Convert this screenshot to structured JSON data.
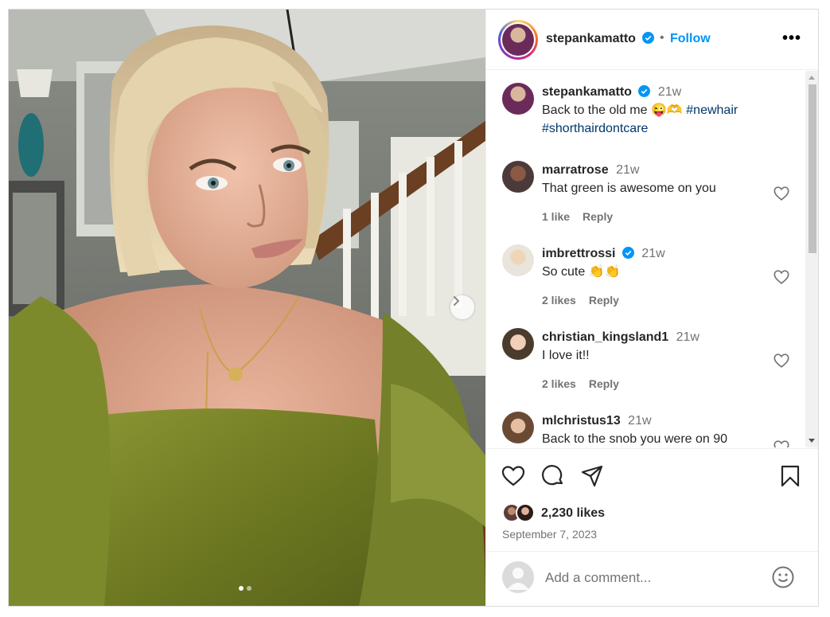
{
  "post": {
    "author": "stepankamatto",
    "follow_label": "Follow",
    "separator": "•",
    "more_label": "•••",
    "carousel_slide": 1,
    "carousel_total": 2
  },
  "caption": {
    "user": "stepankamatto",
    "time": "21w",
    "text": "Back to the old me 😜🫶",
    "hashtag1": "#newhair",
    "hashtag2": "#shorthairdontcare"
  },
  "comments": [
    {
      "user": "marratrose",
      "time": "21w",
      "text": "That green is awesome on you",
      "likes": "1 like",
      "reply": "Reply",
      "verified": false
    },
    {
      "user": "imbrettrossi",
      "time": "21w",
      "text": "So cute 👏👏",
      "likes": "2 likes",
      "reply": "Reply",
      "verified": true
    },
    {
      "user": "christian_kingsland1",
      "time": "21w",
      "text": "I love it!!",
      "likes": "2 likes",
      "reply": "Reply",
      "verified": false
    },
    {
      "user": "mlchristus13",
      "time": "21w",
      "text": "Back to the snob you were on 90",
      "likes": "",
      "reply": "",
      "verified": false
    }
  ],
  "actions": {
    "like_icon": "heart-icon",
    "comment_icon": "comment-icon",
    "share_icon": "send-icon",
    "save_icon": "bookmark-icon"
  },
  "likes": {
    "count_text": "2,230 likes"
  },
  "date": "September 7, 2023",
  "add_comment": {
    "placeholder": "Add a comment..."
  },
  "colors": {
    "accent": "#0095f6",
    "hashtag": "#00376b",
    "muted": "#737373",
    "verified": "#0095f6"
  }
}
